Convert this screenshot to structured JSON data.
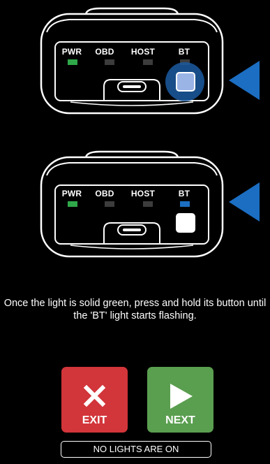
{
  "devices": [
    {
      "leds": {
        "pwr": {
          "label": "PWR",
          "color": "#2fa84a"
        },
        "obd": {
          "label": "OBD",
          "color": "#3c3c3c"
        },
        "host": {
          "label": "HOST",
          "color": "#3c3c3c"
        },
        "bt": {
          "label": "BT",
          "color": "#3c3c3c"
        }
      },
      "button_state": "pressed"
    },
    {
      "leds": {
        "pwr": {
          "label": "PWR",
          "color": "#2fa84a"
        },
        "obd": {
          "label": "OBD",
          "color": "#3c3c3c"
        },
        "host": {
          "label": "HOST",
          "color": "#3c3c3c"
        },
        "bt": {
          "label": "BT",
          "color": "#1b6ec2"
        }
      },
      "button_state": "released"
    }
  ],
  "instruction": "Once the light is solid green, press and hold its button until the 'BT' light starts flashing.",
  "buttons": {
    "exit_label": "EXIT",
    "next_label": "NEXT"
  },
  "no_lights_label": "NO LIGHTS ARE ON",
  "colors": {
    "pointer": "#1b6ec2",
    "exit": "#d2353a",
    "next": "#5a9e4f"
  },
  "icons": {
    "exit": "close-x-icon",
    "next": "play-triangle-icon",
    "pointer": "pointer-arrow-icon"
  }
}
